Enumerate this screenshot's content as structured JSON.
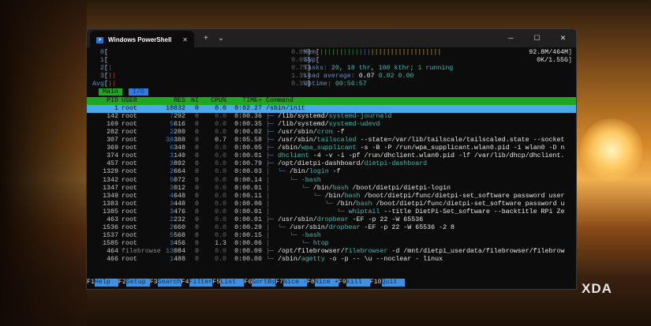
{
  "window": {
    "title": "Windows PowerShell",
    "close": "✕",
    "new_tab": "+",
    "dropdown": "⌄",
    "minimize": "─",
    "maximize": "☐",
    "close_window": "✕"
  },
  "meters": {
    "cpus": [
      {
        "label": "0",
        "value": "0.0%"
      },
      {
        "label": "1",
        "value": "0.0%"
      },
      {
        "label": "2",
        "value": "0.7%"
      },
      {
        "label": "3",
        "value": "1.3%"
      },
      {
        "label": "Avg",
        "value": "0.3%"
      }
    ],
    "mem": {
      "label": "Mem",
      "value": "92.8M/464M"
    },
    "swp": {
      "label": "Swp",
      "value": "0K/1.55G"
    },
    "tasks": {
      "label": "Tasks:",
      "count": "20",
      "thr": "18 thr",
      "kthr": "100 kthr",
      "running_n": "1",
      "running": "running"
    },
    "load": {
      "label": "Load average:",
      "l1": "0.07",
      "l5": "0.02",
      "l15": "0.00"
    },
    "uptime": {
      "label": "Uptime:",
      "value": "00:56:57"
    }
  },
  "tabs": [
    "Main",
    "I/O"
  ],
  "columns": [
    "PID",
    "USER",
    "RES",
    "NI",
    "CPU%",
    "TIME+",
    "Command"
  ],
  "rows": [
    {
      "pid": "1",
      "user": "root",
      "res": "10832",
      "ni": "0",
      "cpu": "0.0",
      "time": "0:02.27",
      "tree": "",
      "dir": "/sbin/init",
      "bin": "",
      "args": ""
    },
    {
      "pid": "142",
      "user": "root",
      "res": "7292",
      "ni": "0",
      "cpu": "0.0",
      "time": "0:00.36",
      "tree": "├─ ",
      "dir": "/lib/systemd/",
      "bin": "systemd-journald",
      "args": ""
    },
    {
      "pid": "169",
      "user": "root",
      "res": "5616",
      "ni": "0",
      "cpu": "0.0",
      "time": "0:00.35",
      "tree": "├─ ",
      "dir": "/lib/systemd/",
      "bin": "systemd-udevd",
      "args": ""
    },
    {
      "pid": "282",
      "user": "root",
      "res": "2280",
      "ni": "0",
      "cpu": "0.0",
      "time": "0:00.02",
      "tree": "├─ ",
      "dir": "/usr/sbin/",
      "bin": "cron",
      "args": " -f"
    },
    {
      "pid": "307",
      "user": "root",
      "res": "39388",
      "ni": "0",
      "cpu": "0.7",
      "time": "0:05.58",
      "tree": "├─ ",
      "dir": "/usr/sbin/",
      "bin": "tailscaled",
      "args": " --state=/var/lib/tailscale/tailscaled.state --socket"
    },
    {
      "pid": "369",
      "user": "root",
      "res": "6348",
      "ni": "0",
      "cpu": "0.0",
      "time": "0:00.05",
      "tree": "├─ ",
      "dir": "/sbin/",
      "bin": "wpa_supplicant",
      "args": " -s -B -P /run/wpa_supplicant.wlan0.pid -i wlan0 -D n"
    },
    {
      "pid": "374",
      "user": "root",
      "res": "3140",
      "ni": "0",
      "cpu": "0.0",
      "time": "0:00.01",
      "tree": "├─ ",
      "dir": "",
      "bin": "dhclient",
      "args": " -4 -v -i -pf /run/dhclient.wlan0.pid -lf /var/lib/dhcp/dhclient."
    },
    {
      "pid": "457",
      "user": "root",
      "res": "3892",
      "ni": "0",
      "cpu": "0.0",
      "time": "0:00.79",
      "tree": "├─ ",
      "dir": "/opt/dietpi-dashboard/",
      "bin": "dietpi-dashboard",
      "args": ""
    },
    {
      "pid": "1329",
      "user": "root",
      "res": "2664",
      "ni": "0",
      "cpu": "0.0",
      "time": "0:00.03",
      "tree": "│  └─ ",
      "dir": "/bin/",
      "bin": "login",
      "args": " -f"
    },
    {
      "pid": "1342",
      "user": "root",
      "res": "5072",
      "ni": "0",
      "cpu": "0.0",
      "time": "0:00.14",
      "tree": "│     └─ ",
      "dir": "",
      "bin": "-bash",
      "args": ""
    },
    {
      "pid": "1347",
      "user": "root",
      "res": "3012",
      "ni": "0",
      "cpu": "0.0",
      "time": "0:00.01",
      "tree": "│        └─ ",
      "dir": "/bin/",
      "bin": "bash",
      "args": " /boot/dietpi/dietpi-login"
    },
    {
      "pid": "1349",
      "user": "root",
      "res": "4648",
      "ni": "0",
      "cpu": "0.0",
      "time": "0:00.11",
      "tree": "│           └─ ",
      "dir": "/bin/",
      "bin": "bash",
      "args": " /boot/dietpi/func/dietpi-set_software password user"
    },
    {
      "pid": "1383",
      "user": "root",
      "res": "3448",
      "ni": "0",
      "cpu": "0.0",
      "time": "0:00.00",
      "tree": "│              └─ ",
      "dir": "/bin/",
      "bin": "bash",
      "args": " /boot/dietpi/func/dietpi-set_software password u"
    },
    {
      "pid": "1385",
      "user": "root",
      "res": "3476",
      "ni": "0",
      "cpu": "0.0",
      "time": "0:00.01",
      "tree": "│                 └─ ",
      "dir": "",
      "bin": "whiptail",
      "args": " --title DietPi-Set_software --backtitle RPi Ze"
    },
    {
      "pid": "463",
      "user": "root",
      "res": "2232",
      "ni": "0",
      "cpu": "0.0",
      "time": "0:00.01",
      "tree": "├─ ",
      "dir": "/usr/sbin/",
      "bin": "dropbear",
      "args": " -EF -p 22 -W 65536"
    },
    {
      "pid": "1536",
      "user": "root",
      "res": "2660",
      "ni": "0",
      "cpu": "0.0",
      "time": "0:00.29",
      "tree": "│  └─ ",
      "dir": "/usr/sbin/",
      "bin": "dropbear",
      "args": " -EF -p 22 -W 65536 -2 8"
    },
    {
      "pid": "1537",
      "user": "root",
      "res": "5568",
      "ni": "0",
      "cpu": "0.0",
      "time": "0:00.15",
      "tree": "│     └─ ",
      "dir": "",
      "bin": "-bash",
      "args": ""
    },
    {
      "pid": "1585",
      "user": "root",
      "res": "3456",
      "ni": "0",
      "cpu": "1.3",
      "time": "0:00.06",
      "tree": "│        └─ ",
      "dir": "",
      "bin": "htop",
      "args": ""
    },
    {
      "pid": "464",
      "user": "filebrowse",
      "res": "13084",
      "ni": "0",
      "cpu": "0.0",
      "time": "0:00.09",
      "tree": "├─ ",
      "dir": "/opt/filebrowser/",
      "bin": "filebrowser",
      "args": " -d /mnt/dietpi_userdata/filebrowser/filebrow"
    },
    {
      "pid": "466",
      "user": "root",
      "res": "1488",
      "ni": "0",
      "cpu": "0.0",
      "time": "0:00.00",
      "tree": "└─ ",
      "dir": "/sbin/",
      "bin": "agetty",
      "args": " -o -p -- \\u --noclear - linux"
    }
  ],
  "fkeys": [
    {
      "key": "F1",
      "label": "Help  "
    },
    {
      "key": "F2",
      "label": "Setup "
    },
    {
      "key": "F3",
      "label": "Search"
    },
    {
      "key": "F4",
      "label": "Filter"
    },
    {
      "key": "F5",
      "label": "List  "
    },
    {
      "key": "F6",
      "label": "SortBy"
    },
    {
      "key": "F7",
      "label": "Nice -"
    },
    {
      "key": "F8",
      "label": "Nice +"
    },
    {
      "key": "F9",
      "label": "Kill  "
    },
    {
      "key": "F10",
      "label": "Quit  "
    }
  ],
  "watermark": "XDA"
}
